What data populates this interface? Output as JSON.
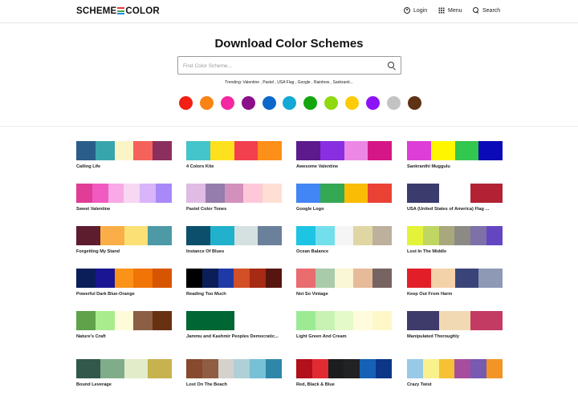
{
  "header": {
    "logo_left": "SCHEME",
    "logo_right": "COLOR",
    "logo_colors": [
      "#e53935",
      "#43a047",
      "#1e88e5"
    ],
    "login_label": "Login",
    "menu_label": "Menu",
    "search_label": "Search"
  },
  "hero": {
    "title": "Download Color Schemes",
    "search_placeholder": "Find Color Scheme...",
    "trending_label": "Trending:",
    "trending": [
      "Valentine",
      "Pastel",
      "USA Flag",
      "Google",
      "Rainbow",
      "Sankranti..."
    ],
    "color_dots": [
      "#f11f14",
      "#fa8413",
      "#f428a1",
      "#8a0f88",
      "#0c69cb",
      "#12a9d6",
      "#13a60f",
      "#8ed90f",
      "#fecb08",
      "#8c13f5",
      "#c3c3c3",
      "#5e3214"
    ]
  },
  "schemes": [
    {
      "name": "Calling Life",
      "colors": [
        "#2a5d8a",
        "#38a5ad",
        "#fbf5c6",
        "#f5625b",
        "#8b2f5e"
      ]
    },
    {
      "name": "4 Colors Kite",
      "colors": [
        "#44c4cb",
        "#fde11f",
        "#f2404f",
        "#fd9018"
      ]
    },
    {
      "name": "Awesome Valentine",
      "colors": [
        "#5c1a8c",
        "#892ee0",
        "#ec87e6",
        "#d51687"
      ]
    },
    {
      "name": "Sankranthi Muggulu",
      "colors": [
        "#dd3ed7",
        "#fff600",
        "#32c74f",
        "#0a0ab9"
      ]
    },
    {
      "name": "Sweet Valentine",
      "colors": [
        "#df3d96",
        "#f15ac0",
        "#f8a9e6",
        "#f7d7f2",
        "#d7b5f8",
        "#a889f7"
      ]
    },
    {
      "name": "Pastel Color Tones",
      "colors": [
        "#e0bbe4",
        "#957dad",
        "#d291bc",
        "#fec8d8",
        "#ffdfd3"
      ]
    },
    {
      "name": "Google Logo",
      "colors": [
        "#4285f4",
        "#34a853",
        "#fbbc05",
        "#ea4335"
      ]
    },
    {
      "name": "USA (United States of America) Flag ...",
      "colors": [
        "#3c3b6e",
        "#ffffff",
        "#b22234"
      ]
    },
    {
      "name": "Forgetting My Stand",
      "colors": [
        "#5e1c2f",
        "#fbae47",
        "#fbe075",
        "#4d9aa6"
      ]
    },
    {
      "name": "Instance Of Blues",
      "colors": [
        "#0b4f6c",
        "#21b1cc",
        "#d5e0e0",
        "#6b809a"
      ]
    },
    {
      "name": "Ocean Balance",
      "colors": [
        "#1dc4e3",
        "#73dfec",
        "#f5f5f5",
        "#e0d6a4",
        "#bdb09d"
      ]
    },
    {
      "name": "Lost In The Middle",
      "colors": [
        "#e2f339",
        "#c0d663",
        "#a8a87c",
        "#8b8a85",
        "#7d71a8",
        "#6446c2"
      ]
    },
    {
      "name": "Powerful Dark Blue-Orange",
      "colors": [
        "#0b1e5a",
        "#1a1693",
        "#fa9317",
        "#f17407",
        "#d75500"
      ]
    },
    {
      "name": "Reading Too Much",
      "colors": [
        "#000000",
        "#0c1e57",
        "#1f3aa6",
        "#d34f26",
        "#a72a14",
        "#571510"
      ]
    },
    {
      "name": "Not So Vintage",
      "colors": [
        "#e96c6f",
        "#a9cba9",
        "#f9f7d5",
        "#e7bb99",
        "#766462"
      ]
    },
    {
      "name": "Keep Out From Harm",
      "colors": [
        "#e21f28",
        "#f4d2a9",
        "#3a4479",
        "#8d99b5"
      ]
    },
    {
      "name": "Nature's Craft",
      "colors": [
        "#5fa24a",
        "#a9ec8d",
        "#fefcd8",
        "#8c5e44",
        "#683112"
      ]
    },
    {
      "name": "Jammu and Kashmir Peoples Democratic...",
      "colors": [
        "#006633",
        "#ffffff"
      ]
    },
    {
      "name": "Light Green And Cream",
      "colors": [
        "#9ceb94",
        "#c7f2b3",
        "#e5fac9",
        "#fefcdc",
        "#fef8c9"
      ]
    },
    {
      "name": "Manipulated Thoroughly",
      "colors": [
        "#3e3b6a",
        "#f1dab3",
        "#c33b63"
      ]
    },
    {
      "name": "Bound Leverage",
      "colors": [
        "#31584a",
        "#80ad89",
        "#e2ecc8",
        "#c6b24e"
      ]
    },
    {
      "name": "Lost On The Beach",
      "colors": [
        "#874a2e",
        "#905d42",
        "#d5d1cc",
        "#afd0d7",
        "#77c0d6",
        "#2e87a8"
      ]
    },
    {
      "name": "Red, Black & Blue",
      "colors": [
        "#b2101a",
        "#e12b33",
        "#1c1d1f",
        "#222224",
        "#1461b6",
        "#0d3588"
      ]
    },
    {
      "name": "Crazy Twist",
      "colors": [
        "#98c9e7",
        "#f9f18c",
        "#f6c133",
        "#a74d9e",
        "#785ab1",
        "#f29426"
      ]
    }
  ]
}
